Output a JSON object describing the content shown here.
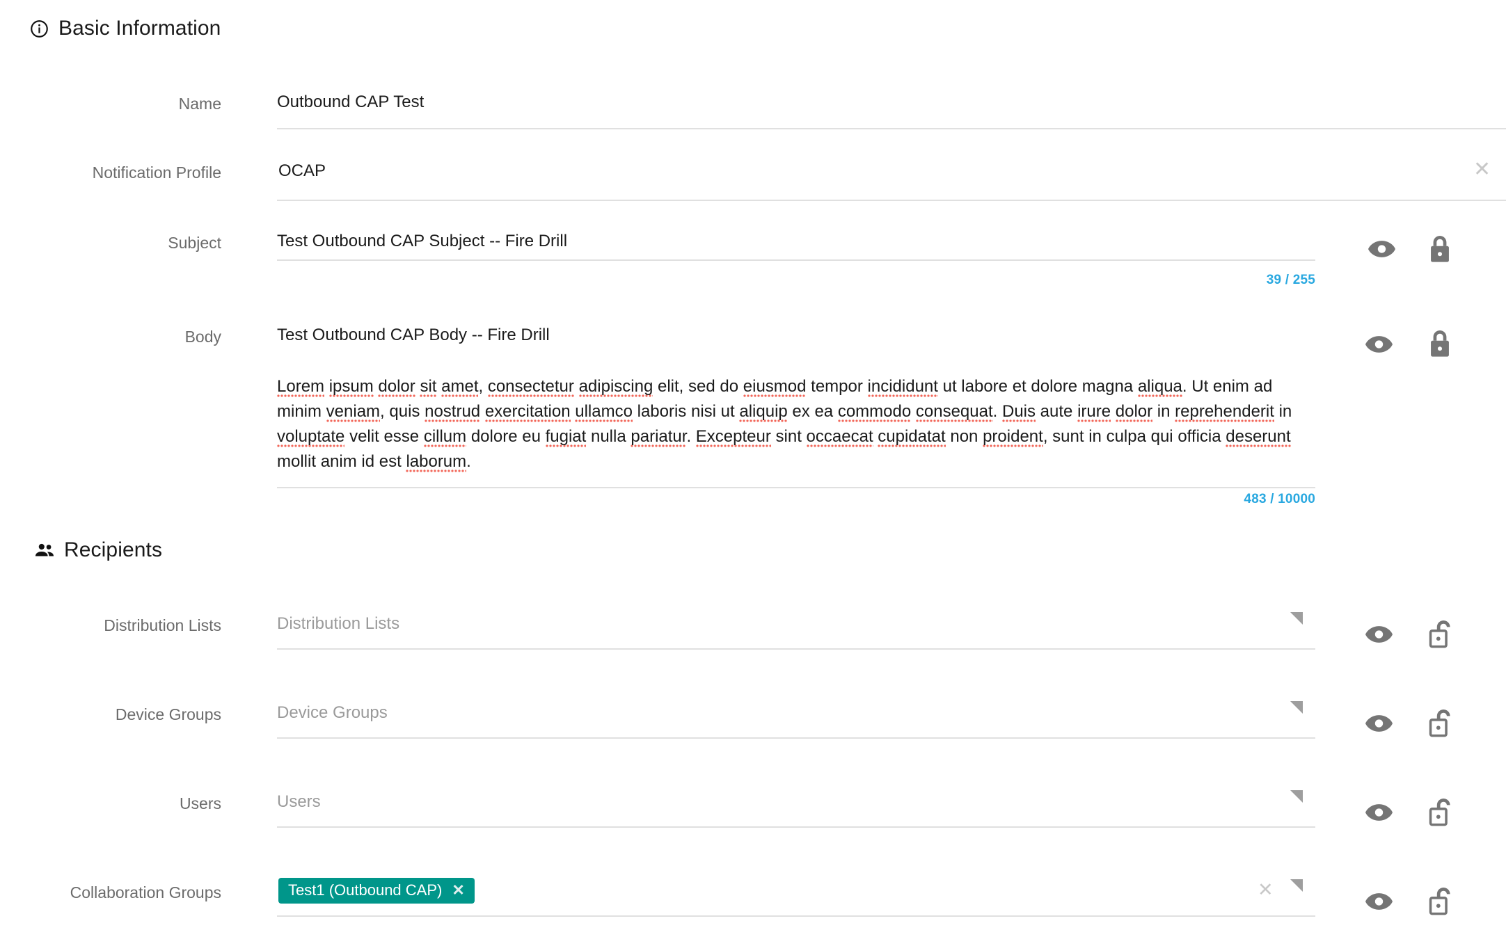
{
  "sections": {
    "basic": {
      "title": "Basic Information",
      "icon": "info-circle-icon"
    },
    "recipients": {
      "title": "Recipients",
      "icon": "people-icon"
    }
  },
  "colors": {
    "accent_counter": "#29a8e0",
    "chip_bg": "#00968a",
    "label": "#6b6b6b",
    "placeholder": "#9a9a9a",
    "underline": "#e0e0e0",
    "icon_gray": "#757575",
    "spellcheck": "#f2685b"
  },
  "fields": {
    "name": {
      "label": "Name",
      "value": "Outbound CAP Test"
    },
    "notification_profile": {
      "label": "Notification Profile",
      "value": "OCAP",
      "clear_icon": "close-x-icon"
    },
    "subject": {
      "label": "Subject",
      "value": "Test Outbound CAP Subject -- Fire Drill",
      "counter": "39 / 255",
      "visibility_icon": "eye-icon",
      "lock_icon": "lock-closed-icon"
    },
    "body": {
      "label": "Body",
      "value": "Test Outbound CAP Body -- Fire Drill",
      "paragraph": "Lorem ipsum dolor sit amet, consectetur adipiscing elit, sed do eiusmod tempor incididunt ut labore et dolore magna aliqua. Ut enim ad minim veniam, quis nostrud exercitation ullamco laboris nisi ut aliquip ex ea commodo consequat. Duis aute irure dolor in reprehenderit in voluptate velit esse cillum dolore eu fugiat nulla pariatur. Excepteur sint occaecat cupidatat non proident, sunt in culpa qui officia deserunt mollit anim id est laborum.",
      "counter": "483 / 10000",
      "visibility_icon": "eye-icon",
      "lock_icon": "lock-closed-icon"
    },
    "distribution_lists": {
      "label": "Distribution Lists",
      "placeholder": "Distribution Lists",
      "value": "",
      "visibility_icon": "eye-icon",
      "lock_icon": "lock-open-icon",
      "resize_icon": "resize-handle-icon"
    },
    "device_groups": {
      "label": "Device Groups",
      "placeholder": "Device Groups",
      "value": "",
      "visibility_icon": "eye-icon",
      "lock_icon": "lock-open-icon",
      "resize_icon": "resize-handle-icon"
    },
    "users": {
      "label": "Users",
      "placeholder": "Users",
      "value": "",
      "visibility_icon": "eye-icon",
      "lock_icon": "lock-open-icon",
      "resize_icon": "resize-handle-icon"
    },
    "collaboration_groups": {
      "label": "Collaboration Groups",
      "placeholder": "",
      "chips": [
        {
          "label": "Test1 (Outbound CAP)",
          "remove_icon": "close-x-icon"
        }
      ],
      "clear_icon": "close-x-icon",
      "visibility_icon": "eye-icon",
      "lock_icon": "lock-open-icon",
      "resize_icon": "resize-handle-icon"
    }
  }
}
